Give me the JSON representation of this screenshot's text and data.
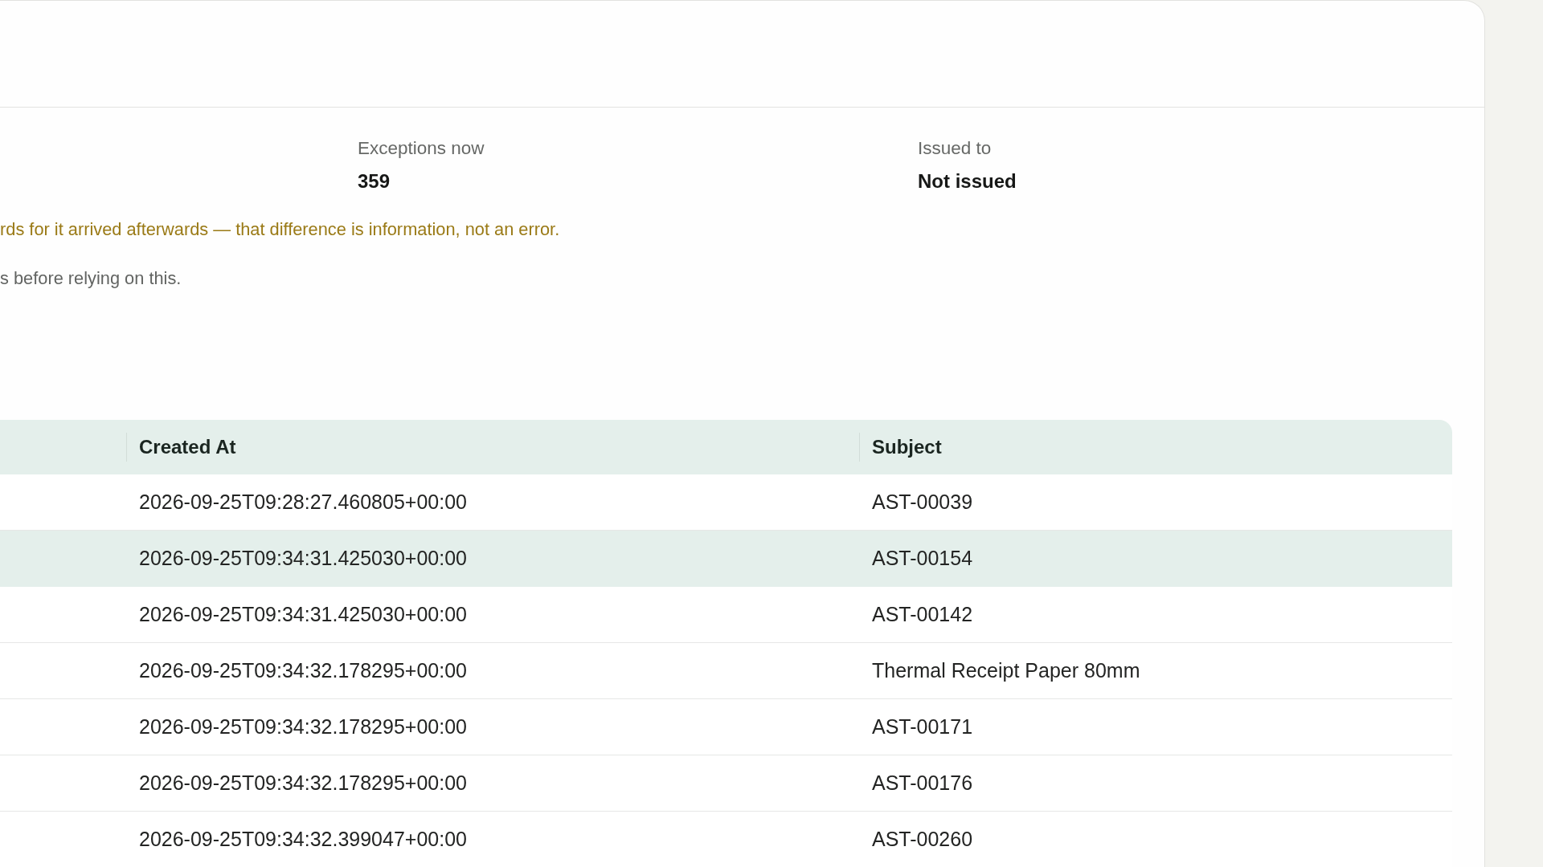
{
  "stats": [
    {
      "label": "Exceptions now",
      "value": "359"
    },
    {
      "label": "Issued to",
      "value": "Not issued"
    }
  ],
  "notes": [
    {
      "kind": "warning",
      "text": "rds for it arrived afterwards — that difference is information, not an error."
    },
    {
      "kind": "hint",
      "text": "s before relying on this."
    }
  ],
  "table": {
    "columns": [
      {
        "label": "Created At"
      },
      {
        "label": "Subject"
      }
    ],
    "rows": [
      {
        "created_at": "2026-09-25T09:28:27.460805+00:00",
        "subject": "AST-00039",
        "selected": false
      },
      {
        "created_at": "2026-09-25T09:34:31.425030+00:00",
        "subject": "AST-00154",
        "selected": true
      },
      {
        "created_at": "2026-09-25T09:34:31.425030+00:00",
        "subject": "AST-00142",
        "selected": false
      },
      {
        "created_at": "2026-09-25T09:34:32.178295+00:00",
        "subject": "Thermal Receipt Paper 80mm",
        "selected": false
      },
      {
        "created_at": "2026-09-25T09:34:32.178295+00:00",
        "subject": "AST-00171",
        "selected": false
      },
      {
        "created_at": "2026-09-25T09:34:32.178295+00:00",
        "subject": "AST-00176",
        "selected": false
      },
      {
        "created_at": "2026-09-25T09:34:32.399047+00:00",
        "subject": "AST-00260",
        "selected": false
      }
    ]
  }
}
